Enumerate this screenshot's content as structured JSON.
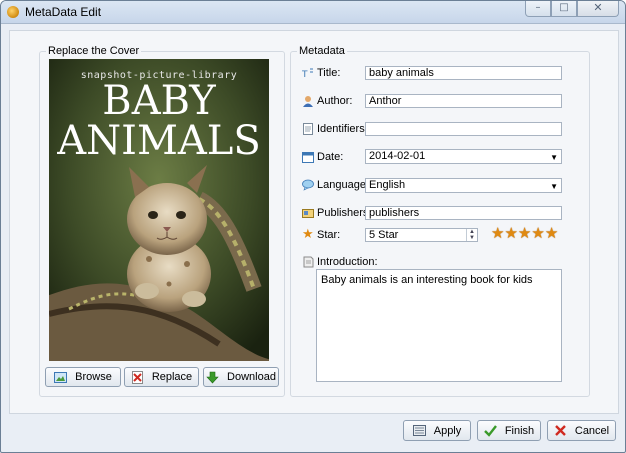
{
  "window": {
    "title": "MetaData Edit",
    "minimize": "–",
    "maximize": "□",
    "close": "✕"
  },
  "cover_group": {
    "label": "Replace the Cover",
    "cover": {
      "series": "snapshot-picture-library",
      "title_line1": "BABY",
      "title_line2": "ANIMALS"
    },
    "buttons": {
      "browse": "Browse",
      "replace": "Replace",
      "download": "Download"
    }
  },
  "metadata_group": {
    "label": "Metadata",
    "fields": {
      "title_label": "Title:",
      "title_value": "baby animals",
      "author_label": "Author:",
      "author_value": "Anthor",
      "identifiers_label": "Identifiers:",
      "identifiers_value": "",
      "date_label": "Date:",
      "date_value": "2014-02-01",
      "language_label": "Language:",
      "language_value": "English",
      "publishers_label": "Publishers",
      "publishers_value": "publishers",
      "star_label": "Star:",
      "star_value": "5 Star",
      "star_rating": 5,
      "introduction_label": "Introduction:",
      "introduction_value": "Baby animals is an interesting book for kids"
    }
  },
  "footer": {
    "apply": "Apply",
    "finish": "Finish",
    "cancel": "Cancel"
  },
  "colors": {
    "accent_star": "#e08a12",
    "finish_check": "#3a9a2a",
    "cancel_x": "#d02a20"
  }
}
